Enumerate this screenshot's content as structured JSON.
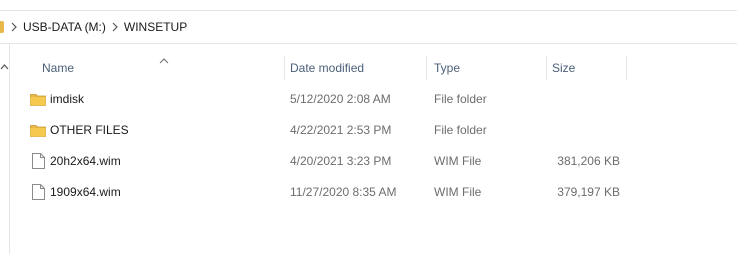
{
  "breadcrumb": {
    "items": [
      {
        "label": "USB-DATA (M:)"
      },
      {
        "label": "WINSETUP"
      }
    ]
  },
  "columns": {
    "name": "Name",
    "date_modified": "Date modified",
    "type": "Type",
    "size": "Size"
  },
  "files": [
    {
      "name": "imdisk",
      "date_modified": "5/12/2020 2:08 AM",
      "type": "File folder",
      "size": "",
      "icon": "folder-icon"
    },
    {
      "name": "OTHER FILES",
      "date_modified": "4/22/2021 2:53 PM",
      "type": "File folder",
      "size": "",
      "icon": "folder-icon"
    },
    {
      "name": "20h2x64.wim",
      "date_modified": "4/20/2021 3:23 PM",
      "type": "WIM File",
      "size": "381,206 KB",
      "icon": "file-icon"
    },
    {
      "name": "1909x64.wim",
      "date_modified": "11/27/2020 8:35 AM",
      "type": "WIM File",
      "size": "379,197 KB",
      "icon": "file-icon"
    }
  ],
  "colors": {
    "folder": "#e8b84a",
    "header_text": "#4c607a",
    "muted_text": "#6d6d6d"
  }
}
